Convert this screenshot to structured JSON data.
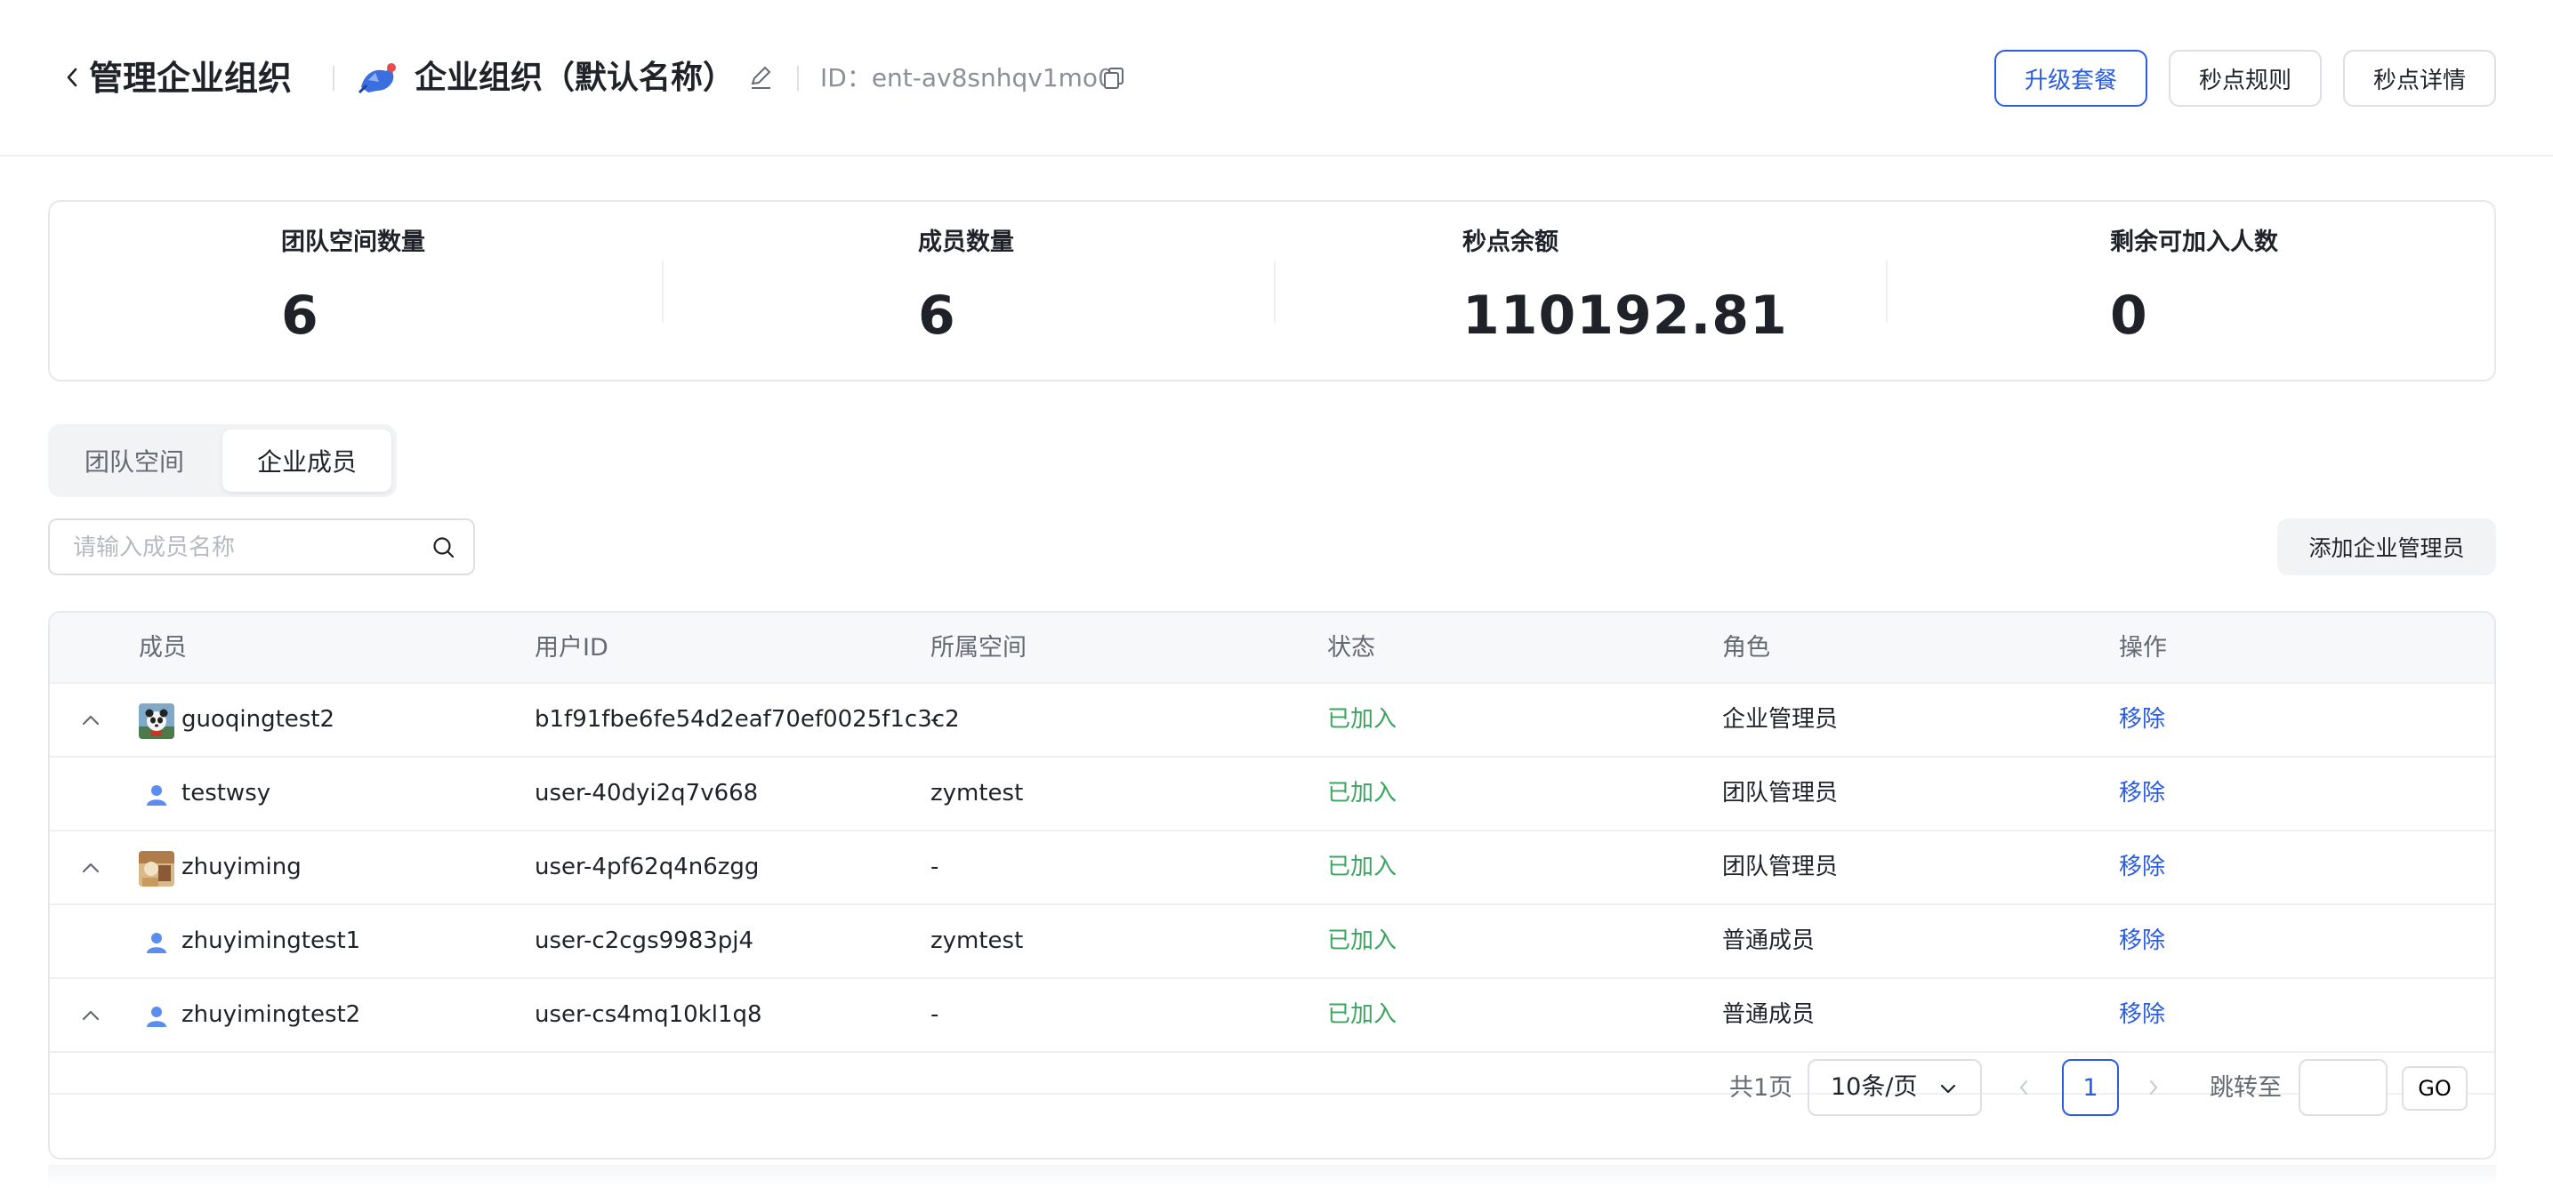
{
  "header": {
    "title": "管理企业组织",
    "org_name": "企业组织（默认名称）",
    "org_id": "ID：ent-av8snhqv1mo0",
    "buttons": {
      "upgrade": "升级套餐",
      "rules": "秒点规则",
      "details": "秒点详情"
    },
    "accent_color": "#2b5ce6"
  },
  "stats": [
    {
      "label": "团队空间数量",
      "value": "6"
    },
    {
      "label": "成员数量",
      "value": "6"
    },
    {
      "label": "秒点余额",
      "value": "110192.81"
    },
    {
      "label": "剩余可加入人数",
      "value": "0"
    }
  ],
  "tabs": [
    {
      "label": "团队空间",
      "active": false
    },
    {
      "label": "企业成员",
      "active": true
    }
  ],
  "search": {
    "placeholder": "请输入成员名称",
    "value": ""
  },
  "add_admin_label": "添加企业管理员",
  "table": {
    "columns": [
      "成员",
      "用户ID",
      "所属空间",
      "状态",
      "角色",
      "操作"
    ],
    "rows": [
      {
        "expandable": true,
        "avatar": "panda-avatar",
        "name": "guoqingtest2",
        "user_id": "b1f91fbe6fe54d2eaf70ef0025f1c3c2",
        "space": "-",
        "status": "已加入",
        "role": "企业管理员",
        "action": "移除"
      },
      {
        "expandable": false,
        "avatar": "user-icon",
        "name": "testwsy",
        "user_id": "user-40dyi2q7v668",
        "space": "zymtest",
        "status": "已加入",
        "role": "团队管理员",
        "action": "移除"
      },
      {
        "expandable": true,
        "avatar": "photo-avatar",
        "name": "zhuyiming",
        "user_id": "user-4pf62q4n6zgg",
        "space": "-",
        "status": "已加入",
        "role": "团队管理员",
        "action": "移除"
      },
      {
        "expandable": false,
        "avatar": "user-icon",
        "name": "zhuyimingtest1",
        "user_id": "user-c2cgs9983pj4",
        "space": "zymtest",
        "status": "已加入",
        "role": "普通成员",
        "action": "移除"
      },
      {
        "expandable": true,
        "avatar": "user-icon",
        "name": "zhuyimingtest2",
        "user_id": "user-cs4mq10kl1q8",
        "space": "-",
        "status": "已加入",
        "role": "普通成员",
        "action": "移除"
      }
    ],
    "status_color": "#3aa55f"
  },
  "pagination": {
    "total": "共1页",
    "page_size": "10条/页",
    "current_page": "1",
    "jump_label": "跳转至",
    "jump_value": "",
    "go_label": "GO"
  }
}
